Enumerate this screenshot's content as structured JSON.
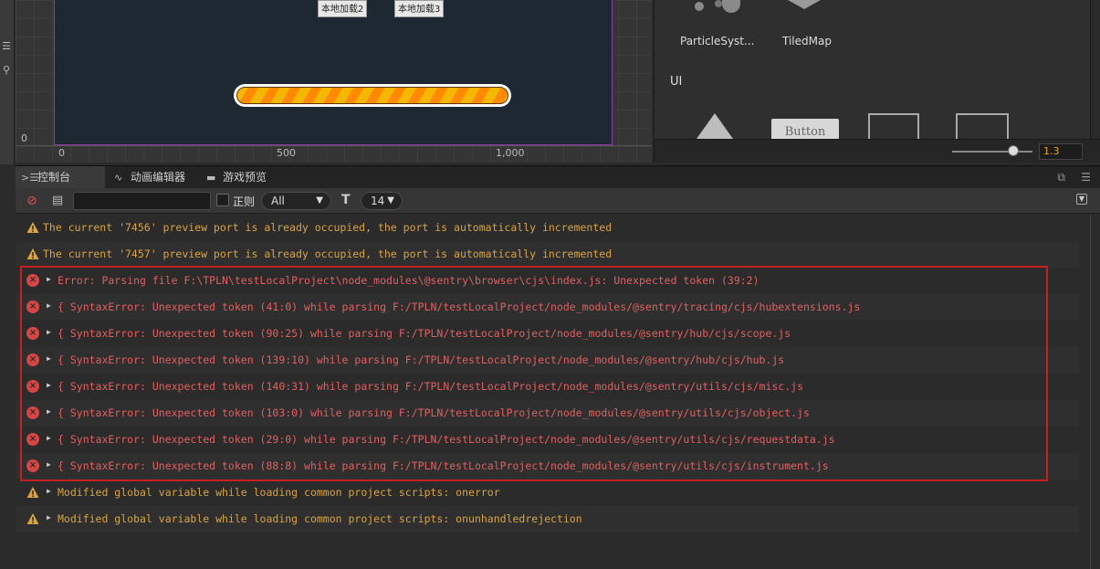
{
  "scene": {
    "buttons": [
      "本地加载2",
      "本地加载3"
    ],
    "ruler_x": [
      "0",
      "500",
      "1,000"
    ],
    "ruler_y": "0",
    "left_icons": [
      "menu-icon",
      "search-icon"
    ]
  },
  "assets": {
    "items": [
      "ParticleSyst...",
      "TiledMap"
    ],
    "section": "UI",
    "button_preview": "Button",
    "zoom": "1.3"
  },
  "console": {
    "tabs": [
      {
        "label": "控制台",
        "icon": "console-icon"
      },
      {
        "label": "动画编辑器",
        "icon": "animation-icon"
      },
      {
        "label": "游戏预览",
        "icon": "game-preview-icon"
      }
    ],
    "toolbar": {
      "search_value": "",
      "regex_label": "正则",
      "level_filter": "All",
      "font_size": "14"
    },
    "logs": [
      {
        "level": "warn",
        "expandable": false,
        "text": "The current '7456' preview port is already occupied, the port is automatically incremented"
      },
      {
        "level": "warn",
        "expandable": false,
        "text": "The current '7457' preview port is already occupied, the port is automatically incremented"
      },
      {
        "level": "error",
        "expandable": true,
        "text": "Error: Parsing file F:\\TPLN\\testLocalProject\\node_modules\\@sentry\\browser\\cjs\\index.js: Unexpected token (39:2)"
      },
      {
        "level": "error",
        "expandable": true,
        "text": "{ SyntaxError: Unexpected token (41:0) while parsing F:/TPLN/testLocalProject/node_modules/@sentry/tracing/cjs/hubextensions.js"
      },
      {
        "level": "error",
        "expandable": true,
        "text": "{ SyntaxError: Unexpected token (90:25) while parsing F:/TPLN/testLocalProject/node_modules/@sentry/hub/cjs/scope.js"
      },
      {
        "level": "error",
        "expandable": true,
        "text": "{ SyntaxError: Unexpected token (139:10) while parsing F:/TPLN/testLocalProject/node_modules/@sentry/hub/cjs/hub.js"
      },
      {
        "level": "error",
        "expandable": true,
        "text": "{ SyntaxError: Unexpected token (140:31) while parsing F:/TPLN/testLocalProject/node_modules/@sentry/utils/cjs/misc.js"
      },
      {
        "level": "error",
        "expandable": true,
        "text": "{ SyntaxError: Unexpected token (103:0) while parsing F:/TPLN/testLocalProject/node_modules/@sentry/utils/cjs/object.js"
      },
      {
        "level": "error",
        "expandable": true,
        "text": "{ SyntaxError: Unexpected token (29:0) while parsing F:/TPLN/testLocalProject/node_modules/@sentry/utils/cjs/requestdata.js"
      },
      {
        "level": "error",
        "expandable": true,
        "text": "{ SyntaxError: Unexpected token (88:8) while parsing F:/TPLN/testLocalProject/node_modules/@sentry/utils/cjs/instrument.js"
      },
      {
        "level": "warn",
        "expandable": true,
        "text": "Modified global variable while loading common project scripts: onerror"
      },
      {
        "level": "warn",
        "expandable": true,
        "text": "Modified global variable while loading common project scripts: onunhandledrejection"
      }
    ]
  },
  "colors": {
    "warn": "#d9a441",
    "error": "#e06060",
    "highlight_border": "#c62020",
    "zoom_text": "#f0a020"
  }
}
